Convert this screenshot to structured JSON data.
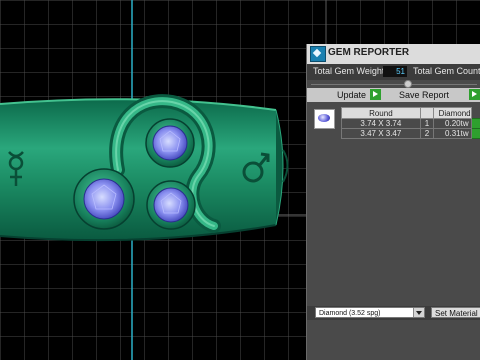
{
  "panel": {
    "title": "GEM REPORTER",
    "total_weight_label": "Total Gem Weight",
    "total_weight_value": "51",
    "total_count_label": "Total Gem Count",
    "update_label": "Update",
    "save_report_label": "Save Report",
    "table": {
      "headers": [
        "Round",
        "",
        "Diamond"
      ],
      "rows": [
        {
          "size": "3.74 X 3.74",
          "qty": "1",
          "weight": "0.20tw"
        },
        {
          "size": "3.47 X 3.47",
          "qty": "2",
          "weight": "0.31tw"
        }
      ]
    },
    "material_select": "Diamond    (3.52 spg)",
    "set_material_label": "Set Material"
  },
  "icons": {
    "left_symbol": "venus-mercury-symbol",
    "right_symbol": "mars-symbol"
  },
  "colors": {
    "ring_green": "#1f8e6a",
    "gem_blue": "#6f74e4",
    "grid_axis": "#2ab0c8",
    "accent_green": "#2ea02e"
  }
}
